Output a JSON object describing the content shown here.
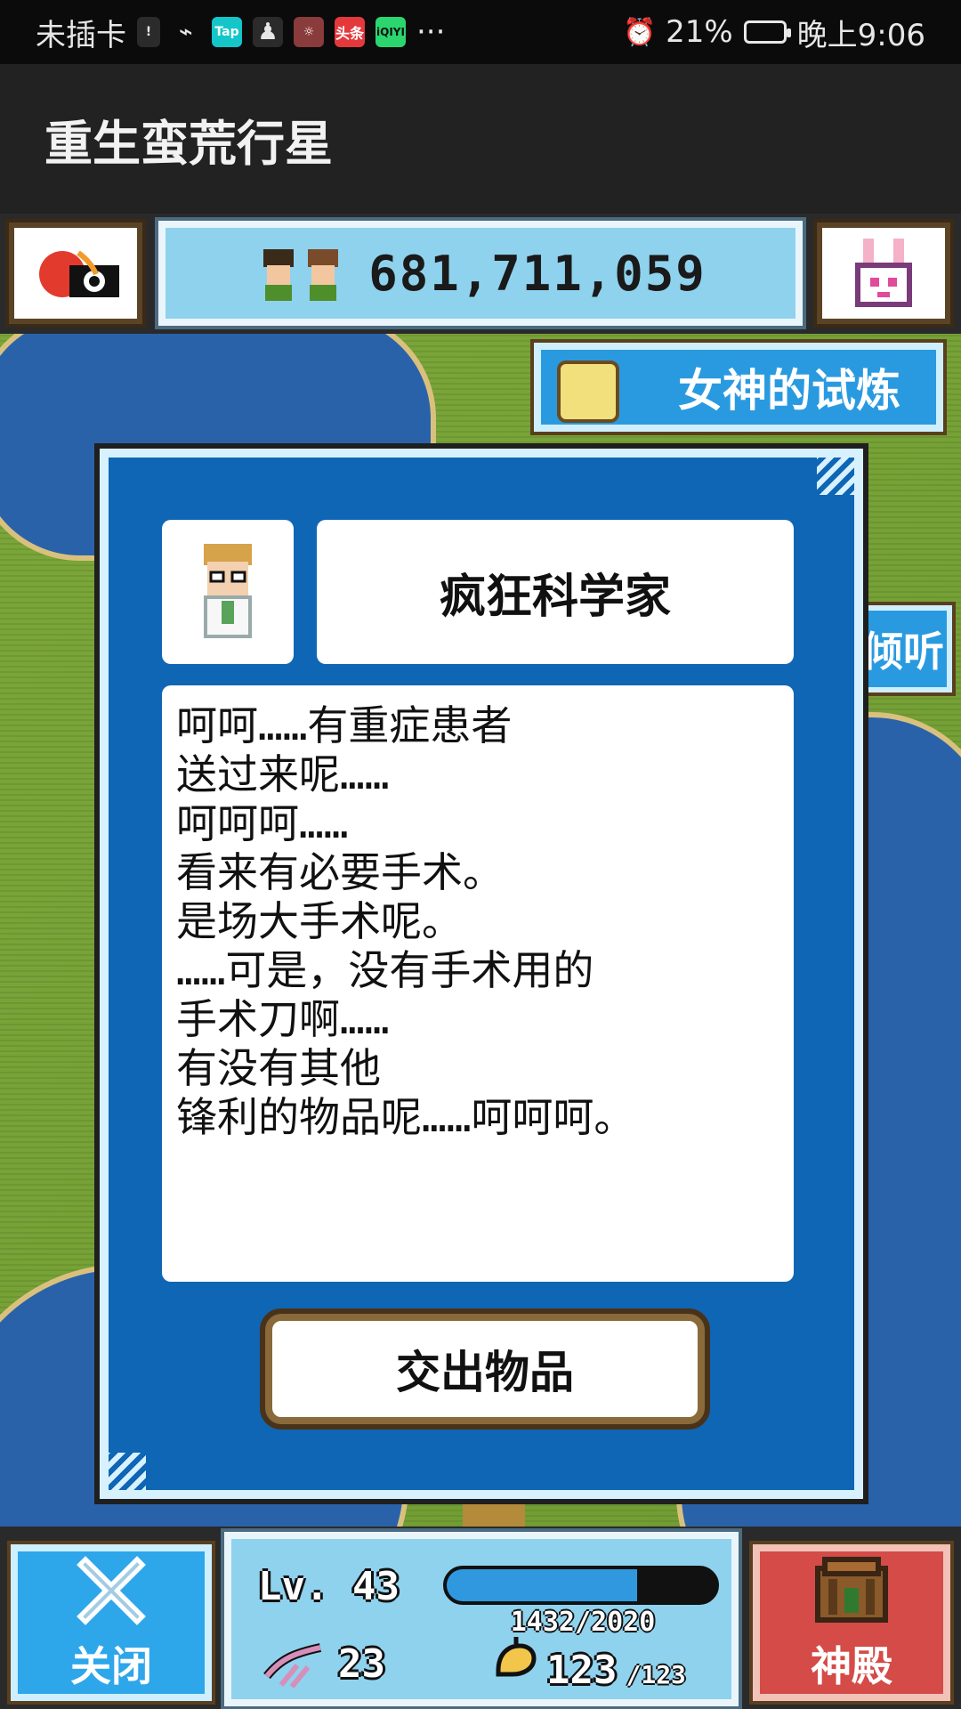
{
  "statusbar": {
    "carrier": "未插卡",
    "battery": "21%",
    "time": "晚上9:06",
    "icons": [
      "sim-alert-icon",
      "wifi-icon",
      "tap-icon",
      "qq-icon",
      "game-icon",
      "toutiao-icon",
      "iqiyi-icon",
      "more-icon",
      "alarm-icon",
      "battery-icon"
    ],
    "more": "···"
  },
  "app": {
    "title": "重生蛮荒行星"
  },
  "hud_top": {
    "money": "681,711,059",
    "trial_label": "女神的试炼",
    "listen_label": "倾听"
  },
  "dialog": {
    "npc_name": "疯狂科学家",
    "lines": [
      "呵呵……有重症患者",
      "送过来呢……",
      "呵呵呵……",
      "看来有必要手术。",
      "是场大手术呢。",
      "……可是，没有手术用的",
      "手术刀啊……",
      "有没有其他",
      "锋利的物品呢……呵呵呵。"
    ],
    "button": "交出物品"
  },
  "hud_bottom": {
    "close_label": "关闭",
    "shrine_label": "神殿",
    "level_text": "Lv. 43",
    "xp_current": 1432,
    "xp_max": 2020,
    "xp_text": "1432/2020",
    "attack": "23",
    "hp": "123",
    "hp_max": "/123"
  },
  "colors": {
    "dialog_blue": "#0f66b5",
    "hud_light_blue": "#8fd2ee",
    "shrine_red": "#d44b48",
    "map_grass": "#7ca73a",
    "river_blue": "#2a62aa"
  }
}
